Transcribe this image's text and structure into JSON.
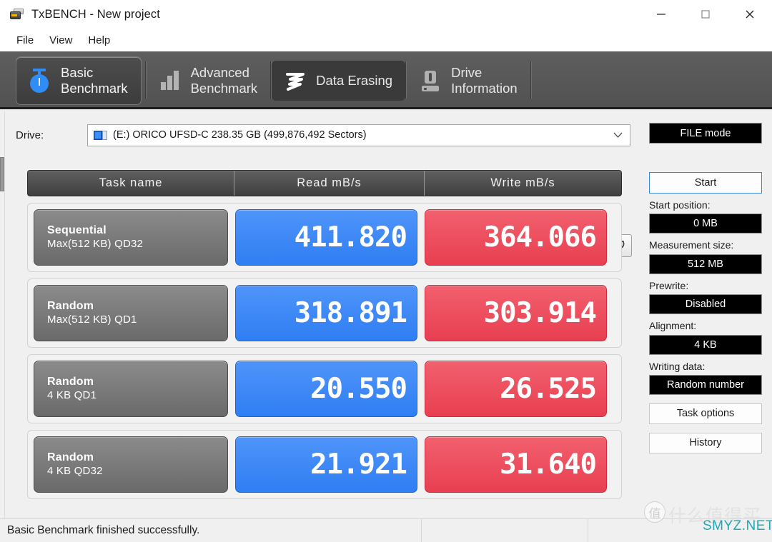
{
  "window": {
    "title": "TxBENCH - New project",
    "icon": "txbench-app-icon",
    "minimize": "—",
    "maximize": "□",
    "close": "✕"
  },
  "menu": {
    "items": [
      {
        "label": "File"
      },
      {
        "label": "View"
      },
      {
        "label": "Help"
      }
    ]
  },
  "tabs": [
    {
      "label": "Basic\nBenchmark",
      "icon": "stopwatch-icon",
      "selected": true
    },
    {
      "label": "Advanced\nBenchmark",
      "icon": "bar-chart-icon",
      "selected": false
    },
    {
      "label": "Data Erasing",
      "icon": "eraser-scribble-icon",
      "selected": false,
      "hover": true
    },
    {
      "label": "Drive\nInformation",
      "icon": "hard-drive-icon",
      "selected": false
    }
  ],
  "drive": {
    "label": "Drive:",
    "value": "(E:) ORICO UFSD-C  238.35 GB (499,876,492 Sectors)",
    "icon": "removable-drive-icon",
    "chevron": "chevron-down-icon",
    "refresh_icon": "refresh-icon"
  },
  "results": {
    "headers": {
      "task": "Task name",
      "read": "Read mB/s",
      "write": "Write mB/s"
    },
    "rows": [
      {
        "name_line1": "Sequential",
        "name_line2": "Max(512 KB) QD32",
        "read": "411.820",
        "write": "364.066"
      },
      {
        "name_line1": "Random",
        "name_line2": "Max(512 KB) QD1",
        "read": "318.891",
        "write": "303.914"
      },
      {
        "name_line1": "Random",
        "name_line2": "4 KB QD1",
        "read": "20.550",
        "write": "26.525"
      },
      {
        "name_line1": "Random",
        "name_line2": "4 KB QD32",
        "read": "21.921",
        "write": "31.640"
      }
    ]
  },
  "sidebar": {
    "mode": "FILE mode",
    "start": "Start",
    "start_position_label": "Start position:",
    "start_position_value": "0 MB",
    "measurement_size_label": "Measurement size:",
    "measurement_size_value": "512 MB",
    "prewrite_label": "Prewrite:",
    "prewrite_value": "Disabled",
    "alignment_label": "Alignment:",
    "alignment_value": "4 KB",
    "writing_data_label": "Writing data:",
    "writing_data_value": "Random number",
    "task_options": "Task options",
    "history": "History"
  },
  "status": {
    "message": "Basic Benchmark finished successfully."
  },
  "watermark": {
    "badge": "值",
    "cn": "什么值得买",
    "site": "SMYZ.NET"
  },
  "colors": {
    "read_blue": "#3d84f5",
    "write_red": "#ee4f5f",
    "tabstrip": "#5a5a5a",
    "accent_focus": "#3b8ad9",
    "watermark_teal": "#1fa8b8"
  }
}
